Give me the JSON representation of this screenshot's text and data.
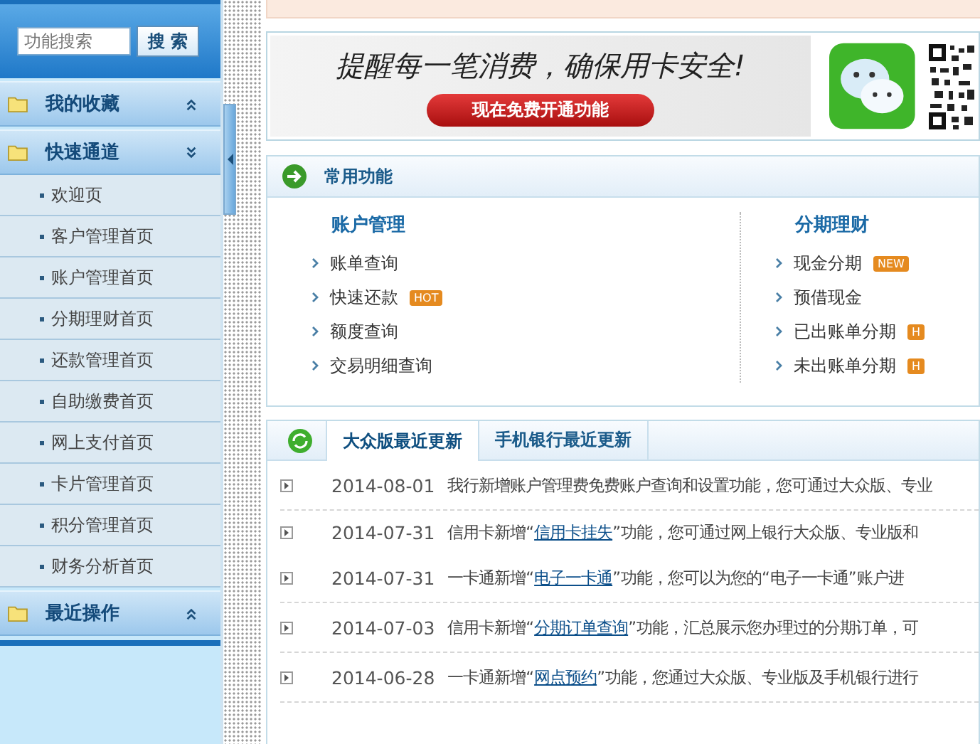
{
  "sidebar": {
    "search": {
      "placeholder": "功能搜索",
      "button": "搜 索"
    },
    "groups": [
      {
        "title": "我的收藏",
        "expanded": false
      },
      {
        "title": "快速通道",
        "expanded": true,
        "items": [
          "欢迎页",
          "客户管理首页",
          "账户管理首页",
          "分期理财首页",
          "还款管理首页",
          "自助缴费首页",
          "网上支付首页",
          "卡片管理首页",
          "积分管理首页",
          "财务分析首页"
        ]
      },
      {
        "title": "最近操作",
        "expanded": false
      }
    ]
  },
  "banner": {
    "headline": "提醒每一笔消费，确保用卡安全!",
    "button": "现在免费开通功能"
  },
  "common_functions": {
    "title": "常用功能",
    "columns": [
      {
        "heading": "账户管理",
        "items": [
          {
            "label": "账单查询"
          },
          {
            "label": "快速还款",
            "badge": "HOT"
          },
          {
            "label": "额度查询"
          },
          {
            "label": "交易明细查询"
          }
        ]
      },
      {
        "heading": "分期理财",
        "items": [
          {
            "label": "现金分期",
            "badge": "NEW"
          },
          {
            "label": "预借现金"
          },
          {
            "label": "已出账单分期",
            "badge": "H"
          },
          {
            "label": "未出账单分期",
            "badge": "H"
          }
        ]
      }
    ]
  },
  "updates": {
    "tabs": [
      {
        "label": "大众版最近更新",
        "selected": true
      },
      {
        "label": "手机银行最近更新",
        "selected": false
      }
    ],
    "rows": [
      {
        "date": "2014-08-01",
        "before": "我行新增账户管理费免费账户查询和设置功能，您可通过大众版、专业"
      },
      {
        "date": "2014-07-31",
        "before": "信用卡新增“",
        "link": "信用卡挂失",
        "after": "”功能，您可通过网上银行大众版、专业版和"
      },
      {
        "date": "2014-07-31",
        "before": "一卡通新增“",
        "link": "电子一卡通",
        "after": "”功能，您可以为您的“电子一卡通”账户进"
      },
      {
        "date": "2014-07-03",
        "before": "信用卡新增“",
        "link": "分期订单查询",
        "after": "”功能，汇总展示您办理过的分期订单，可"
      },
      {
        "date": "2014-06-28",
        "before": "一卡通新增“",
        "link": "网点预约",
        "after": "”功能，您通过大众版、专业版及手机银行进行"
      }
    ]
  }
}
